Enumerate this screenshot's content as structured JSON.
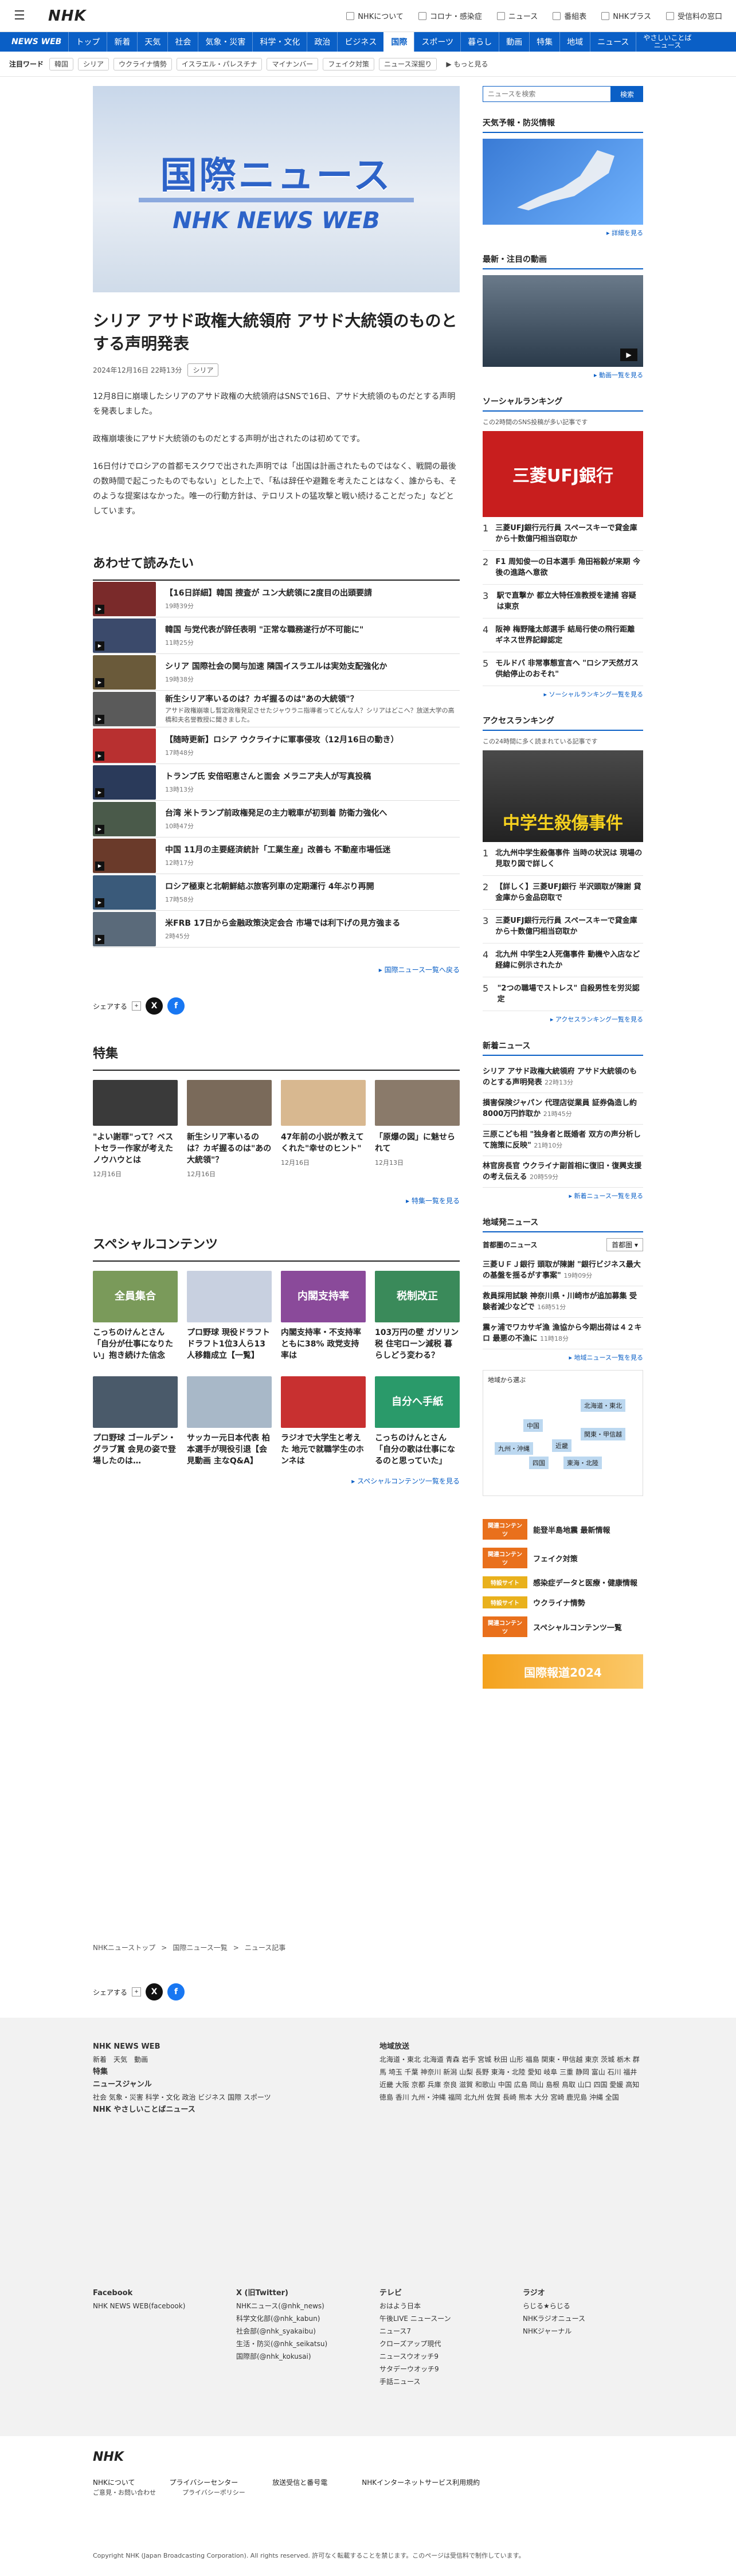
{
  "header": {
    "logo": "NHK",
    "links": [
      "NHKについて",
      "コロナ・感染症",
      "ニュース",
      "番組表",
      "NHKプラス",
      "受信料の窓口"
    ]
  },
  "nav": {
    "brand": "NEWS WEB",
    "items": [
      "トップ",
      "新着",
      "天気",
      "社会",
      "気象・災害",
      "科学・文化",
      "政治",
      "ビジネス",
      "国際",
      "スポーツ",
      "暮らし",
      "動画",
      "特集",
      "地域",
      "ニュース"
    ],
    "active": "国際",
    "split_top": "やさしいことば",
    "split_bottom": "ニュース"
  },
  "keywords": {
    "label": "注目ワード",
    "items": [
      "韓国",
      "シリア",
      "ウクライナ情勢",
      "イスラエル・パレスチナ",
      "マイナンバー",
      "フェイク対策",
      "ニュース深掘り"
    ],
    "more": "もっと見る"
  },
  "hero": {
    "line1": "国際ニュース",
    "line2": "NHK NEWS WEB"
  },
  "article": {
    "title": "シリア アサド政権大統領府 アサド大統領のものとする声明発表",
    "date": "2024年12月16日 22時13分",
    "tag": "シリア",
    "paragraphs": [
      "12月8日に崩壊したシリアのアサド政権の大統領府はSNSで16日、アサド大統領のものだとする声明を発表しました。",
      "政権崩壊後にアサド大統領のものだとする声明が出されたのは初めてです。",
      "16日付けでロシアの首都モスクワで出された声明では「出国は計画されたものではなく、戦闘の最後の数時間で起こったものでもない」とした上で、「私は辞任や避難を考えたことはなく、誰からも、そのような提案はなかった。唯一の行動方針は、テロリストの猛攻撃と戦い続けることだった」などとしています。"
    ]
  },
  "related": {
    "heading": "あわせて読みたい",
    "items": [
      {
        "title": "【16日詳細】韓国 捜査が ユン大統領に2度目の出頭要請",
        "date": "19時39分",
        "c": "#7a2a2a"
      },
      {
        "title": "韓国 与党代表が辞任表明 \"正常な職務遂行が不可能に\"",
        "date": "11時25分",
        "c": "#3b4a6b"
      },
      {
        "title": "シリア 国際社会の関与加速 隣国イスラエルは実効支配強化か",
        "date": "19時38分",
        "c": "#6a5a3a"
      },
      {
        "title": "新生シリア率いるのは？カギ握るのは\"あの大統領\"？",
        "sub": "アサド政権崩壊し暫定政権発足させたジャウラニ指導者ってどんな人？シリアはどこへ？放送大学の高橋和夫名誉教授に聞きました。",
        "date": "",
        "c": "#5a5a5a"
      },
      {
        "title": "【随時更新】ロシア ウクライナに軍事侵攻（12月16日の動き）",
        "date": "17時48分",
        "c": "#b83030"
      },
      {
        "title": "トランプ氏 安倍昭恵さんと面会 メラニア夫人が写真投稿",
        "date": "13時13分",
        "c": "#2a3a5a"
      },
      {
        "title": "台湾 米トランプ前政権発足の主力戦車が初到着 防衛力強化へ",
        "date": "10時47分",
        "c": "#4a5a4a"
      },
      {
        "title": "中国 11月の主要経済統計「工業生産」改善も 不動産市場低迷",
        "date": "12時17分",
        "c": "#6a3a2a"
      },
      {
        "title": "ロシア極東と北朝鮮結ぶ旅客列車の定期運行 4年ぶり再開",
        "date": "17時58分",
        "c": "#3a5a7a"
      },
      {
        "title": "米FRB 17日から金融政策決定会合 市場では利下げの見方強まる",
        "date": "2時45分",
        "c": "#5a6a7a"
      }
    ],
    "more": "国際ニュース一覧へ戻る"
  },
  "share": {
    "label": "シェアする"
  },
  "features": {
    "heading": "特集",
    "items": [
      {
        "title": "\"よい謝罪\"って？ベストセラー作家が考えたノウハウとは",
        "date": "12月16日",
        "c": "#3a3a3a"
      },
      {
        "title": "新生シリア率いるのは？カギ握るのは\"あの大統領\"？",
        "date": "12月16日",
        "c": "#7a6a5a"
      },
      {
        "title": "47年前の小説が教えてくれた\"幸せのヒント\"",
        "date": "12月16日",
        "c": "#d8b890"
      },
      {
        "title": "「原爆の図」に魅せられて",
        "date": "12月13日",
        "c": "#8a7a6a"
      }
    ],
    "more": "特集一覧を見る"
  },
  "special": {
    "heading": "スペシャルコンテンツ",
    "items": [
      {
        "title": "こっちのけんとさん「自分が仕事になりたい」抱き続けた信念",
        "img": "全員集合",
        "c": "#7a9a5a"
      },
      {
        "title": "プロ野球 現役ドラフト ドラフト1位3人ら13人移籍成立【一覧】",
        "img": "",
        "c": "#c8d0e0"
      },
      {
        "title": "内閣支持率・不支持率ともに38% 政党支持率は",
        "img": "内閣支持率",
        "c": "#8a4a9a"
      },
      {
        "title": "103万円の壁 ガソリン税 住宅ローン減税 暮らしどう変わる？",
        "img": "税制改正",
        "c": "#3a8a5a"
      },
      {
        "title": "プロ野球 ゴールデン・グラブ賞 会見の姿で登場したのは…",
        "img": "",
        "c": "#4a5a6a"
      },
      {
        "title": "サッカー元日本代表 柏本選手が現役引退【会見動画 主なQ&A】",
        "img": "",
        "c": "#a8b8c8"
      },
      {
        "title": "ラジオで大学生と考えた 地元で就職学生のホンネは",
        "img": "",
        "c": "#c83030"
      },
      {
        "title": "こっちのけんとさん「自分の歌は仕事になるのと思っていた」",
        "img": "自分へ手紙",
        "c": "#2a9a6a"
      }
    ],
    "more": "スペシャルコンテンツ一覧を見る"
  },
  "breadcrumb": [
    "NHKニューストップ",
    "国際ニュース一覧",
    "ニュース記事"
  ],
  "sidebar": {
    "search_placeholder": "ニュースを検索",
    "search_btn": "検索",
    "weather": {
      "heading": "天気予報・防災情報",
      "more": "詳細を見る"
    },
    "video": {
      "heading": "最新・注目の動画",
      "more": "動画一覧を見る"
    },
    "social": {
      "heading": "ソーシャルランキング",
      "note": "この2時間のSNS投稿が多い記事です",
      "items": [
        "三菱UFJ銀行元行員 スペースキーで貸金庫から十数億円相当窃取か",
        "F1 周知俊一の日本選手 角田裕毅が来期 今後の進路へ意欲",
        "駅で直撃か 都立大特任准教授を逮捕 容疑は東京",
        "阪神 梅野隆太郎選手 結局行使の飛行距離 ギネス世界記録認定",
        "モルドバ 非常事態宣言へ \"ロシア天然ガス供給停止のおそれ\""
      ],
      "more": "ソーシャルランキング一覧を見る",
      "img": "三菱UFJ銀行"
    },
    "access": {
      "heading": "アクセスランキング",
      "note": "この24時間に多く読まれている記事です",
      "items": [
        "北九州中学生殺傷事件 当時の状況は 現場の見取り図で詳しく",
        "【詳しく】三菱UFJ銀行 半沢頭取が陳謝 貸金庫から金品窃取で",
        "三菱UFJ銀行元行員 スペースキーで貸金庫から十数億円相当窃取か",
        "北九州 中学生2人死傷事件 動機や入店など経緯に例示されたか",
        "\"2つの職場でストレス\" 自殺男性を労災認定"
      ],
      "more": "アクセスランキング一覧を見る",
      "img": "中学生殺傷事件"
    },
    "newlist": {
      "heading": "新着ニュース",
      "items": [
        {
          "t": "シリア アサド政権大統領府 アサド大統領のものとする声明発表",
          "d": "22時13分"
        },
        {
          "t": "損害保険ジャパン 代理店従業員 証券偽造し約8000万円詐取か",
          "d": "21時45分"
        },
        {
          "t": "三原こども相 \"独身者と既婚者 双方の声分析して施策に反映\"",
          "d": "21時10分"
        },
        {
          "t": "林官房長官 ウクライナ副首相に復旧・復興支援の考え伝える",
          "d": "20時59分"
        }
      ],
      "more": "新着ニュース一覧を見る"
    },
    "regional": {
      "heading": "地域発ニュース",
      "label": "首都圏のニュース",
      "select": "首都圏",
      "items": [
        {
          "t": "三菱ＵＦＪ銀行 頭取が陳謝 \"銀行ビジネス最大の基盤を揺るがす事案\"",
          "d": "19時09分"
        },
        {
          "t": "救員採用試験 神奈川県・川崎市が追加募集 受験者減少などで",
          "d": "16時51分"
        },
        {
          "t": "震ヶ浦でワカサギ漁 漁協から今期出荷は４２キロ 最悪の不漁に",
          "d": "11時18分"
        }
      ],
      "more": "地域ニュース一覧を見る",
      "map_label": "地域から選ぶ"
    },
    "map": {
      "hokkaido": "北海道・東北",
      "kanto": "関東・甲信越",
      "kinki": "近畿",
      "chugoku": "中国",
      "kyushu": "九州・沖縄",
      "tokai": "東海・北陸",
      "shikoku": "四国"
    },
    "banners": [
      {
        "l": "関連コンテンツ",
        "t": "能登半島地震 最新情報"
      },
      {
        "l": "関連コンテンツ",
        "t": "フェイク対策"
      },
      {
        "l": "特設サイト",
        "t": "感染症データと医療・健康情報"
      },
      {
        "l": "特設サイト",
        "t": "ウクライナ情勢"
      },
      {
        "l": "関連コンテンツ",
        "t": "スペシャルコンテンツ一覧"
      }
    ],
    "promo": "国際報道2024"
  },
  "footer": {
    "brand": "NHK NEWS WEB",
    "links1": [
      "新着",
      "天気",
      "動画"
    ],
    "feature": "特集",
    "genre": "ニュースジャンル",
    "genres": "社会 気象・災害 科学・文化 政治 ビジネス 国際 スポーツ",
    "easy": "NHK やさしいことばニュース",
    "region_head": "地域放送",
    "pref": "北海道・東北 北海道 青森 岩手 宮城 秋田 山形 福島 関東・甲信越 東京 茨城 栃木 群馬 埼玉 千葉 神奈川 新潟 山梨 長野 東海・北陸 愛知 岐阜 三重 静岡 富山 石川 福井 近畿 大阪 京都 兵庫 奈良 滋賀 和歌山 中国 広島 岡山 島根 鳥取 山口 四国 愛媛 高知 徳島 香川 九州・沖縄 福岡 北九州 佐賀 長崎 熊本 大分 宮崎 鹿児島 沖縄 全国",
    "fb_head": "Facebook",
    "fb": "NHK NEWS WEB(facebook)",
    "x_head": "X (旧Twitter)",
    "x": [
      "NHKニュース(@nhk_news)",
      "科学文化部(@nhk_kabun)",
      "社会部(@nhk_syakaibu)",
      "生活・防災(@nhk_seikatsu)",
      "国際部(@nhk_kokusai)"
    ],
    "tv_head": "テレビ",
    "tv": [
      "おはよう日本",
      "午後LIVE ニュースーン",
      "ニュース7",
      "クローズアップ現代",
      "ニュースウオッチ9",
      "サタデーウオッチ9",
      "手話ニュース"
    ],
    "radio_head": "ラジオ",
    "radio": [
      "らじる★らじる",
      "NHKラジオニュース",
      "NHKジャーナル"
    ],
    "bottom": [
      "NHKについて",
      "プライバシーセンター",
      "放送受信と番号電",
      "NHKインターネットサービス利用規約"
    ],
    "sub": "ご意見・お問い合わせ",
    "sub2": "プライバシーポリシー",
    "copy": "Copyright NHK (Japan Broadcasting Corporation). All rights reserved. 許可なく転載することを禁じます。このページは受信料で制作しています。",
    "nhk": "NHK"
  }
}
